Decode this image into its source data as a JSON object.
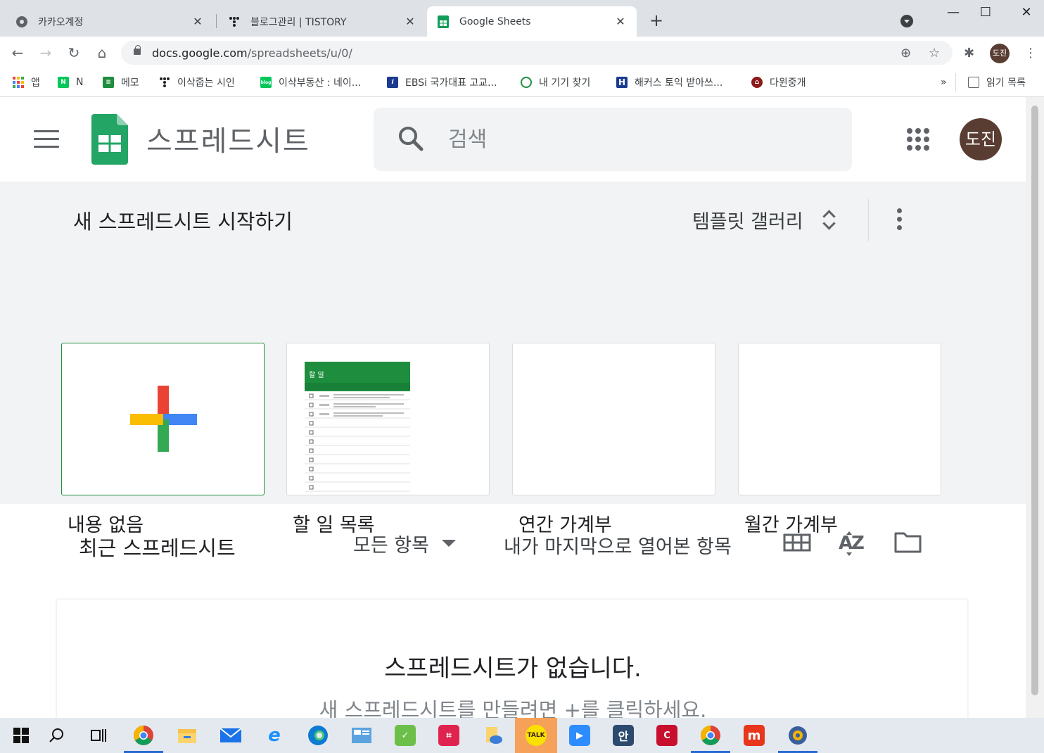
{
  "browser": {
    "tabs": [
      {
        "title": "카카오계정",
        "favicon": "kakao-icon",
        "active": false
      },
      {
        "title": "블로그관리 | TISTORY",
        "favicon": "tistory-icon",
        "active": false
      },
      {
        "title": "Google Sheets",
        "favicon": "sheets-icon",
        "active": true
      }
    ],
    "tab_close_glyph": "✕",
    "new_tab_glyph": "+",
    "window_controls": {
      "minimize": "—",
      "maximize": "☐",
      "close": "✕"
    },
    "url": {
      "host": "docs.google.com",
      "path": "/spreadsheets/u/0/"
    },
    "profile_initials": "도진",
    "nav": {
      "back": "←",
      "forward": "→",
      "reload": "↻",
      "home": "⌂"
    },
    "omnibox_icons": {
      "zoom": "⊕",
      "star": "☆",
      "extensions": "✱",
      "menu": "⋮"
    }
  },
  "bookmarks": {
    "items": [
      {
        "label": "앱",
        "icon": "apps-icon",
        "color": "#ea4335"
      },
      {
        "label": "N",
        "icon": "naver-icon",
        "color": "#03c75a"
      },
      {
        "label": "메모",
        "icon": "memo-icon",
        "color": "#1e8e3e"
      },
      {
        "label": "이삭줍는 시인",
        "icon": "tistory-icon",
        "color": "#202124"
      },
      {
        "label": "이삭부동산 : 네이...",
        "icon": "blog-icon",
        "color": "#03c75a"
      },
      {
        "label": "EBSi 국가대표 고교...",
        "icon": "ebsi-icon",
        "color": "#1a3b8f"
      },
      {
        "label": "내 기기 찾기",
        "icon": "find-device-icon",
        "color": "#1e8e3e"
      },
      {
        "label": "해커스 토익 받아쓰...",
        "icon": "hackers-icon",
        "color": "#1a3b8f"
      },
      {
        "label": "다윈중개",
        "icon": "darwin-icon",
        "color": "#8b1a1a"
      }
    ],
    "overflow": "»",
    "reading_list": "읽기 목록"
  },
  "app": {
    "title": "스프레드시트",
    "search": {
      "placeholder": "검색"
    },
    "avatar_initials": "도진"
  },
  "templates": {
    "heading": "새 스프레드시트 시작하기",
    "gallery_label": "템플릿 갤러리",
    "cards": [
      {
        "label": "내용 없음"
      },
      {
        "label": "할 일 목록"
      },
      {
        "label": "연간 가계부"
      },
      {
        "label": "월간 가계부"
      }
    ],
    "todo_thumb": {
      "header": "할 일"
    }
  },
  "recent": {
    "heading": "최근 스프레드시트",
    "owner_filter": "모든 항목",
    "sort_label": "내가 마지막으로 열어본 항목",
    "empty_title": "스프레드시트가 없습니다.",
    "empty_subtitle": "새 스프레드시트를 만들려면 +를 클릭하세요."
  },
  "taskbar": {
    "items": [
      {
        "name": "start-icon"
      },
      {
        "name": "search-icon"
      },
      {
        "name": "task-view-icon"
      },
      {
        "name": "chrome-icon",
        "running": true
      },
      {
        "name": "file-explorer-icon"
      },
      {
        "name": "mail-icon"
      },
      {
        "name": "internet-explorer-icon"
      },
      {
        "name": "edge-icon"
      },
      {
        "name": "control-panel-icon"
      },
      {
        "name": "green-app-icon"
      },
      {
        "name": "crop-tool-icon"
      },
      {
        "name": "folder-cloud-icon"
      },
      {
        "name": "kakaotalk-icon",
        "label": "TALK"
      },
      {
        "name": "zoom-icon"
      },
      {
        "name": "hangul-icon",
        "label": "안"
      },
      {
        "name": "red-app-icon"
      },
      {
        "name": "chrome-icon-2",
        "running": true
      },
      {
        "name": "m-app-icon",
        "label": "m"
      },
      {
        "name": "media-app-icon",
        "running": true
      }
    ]
  }
}
